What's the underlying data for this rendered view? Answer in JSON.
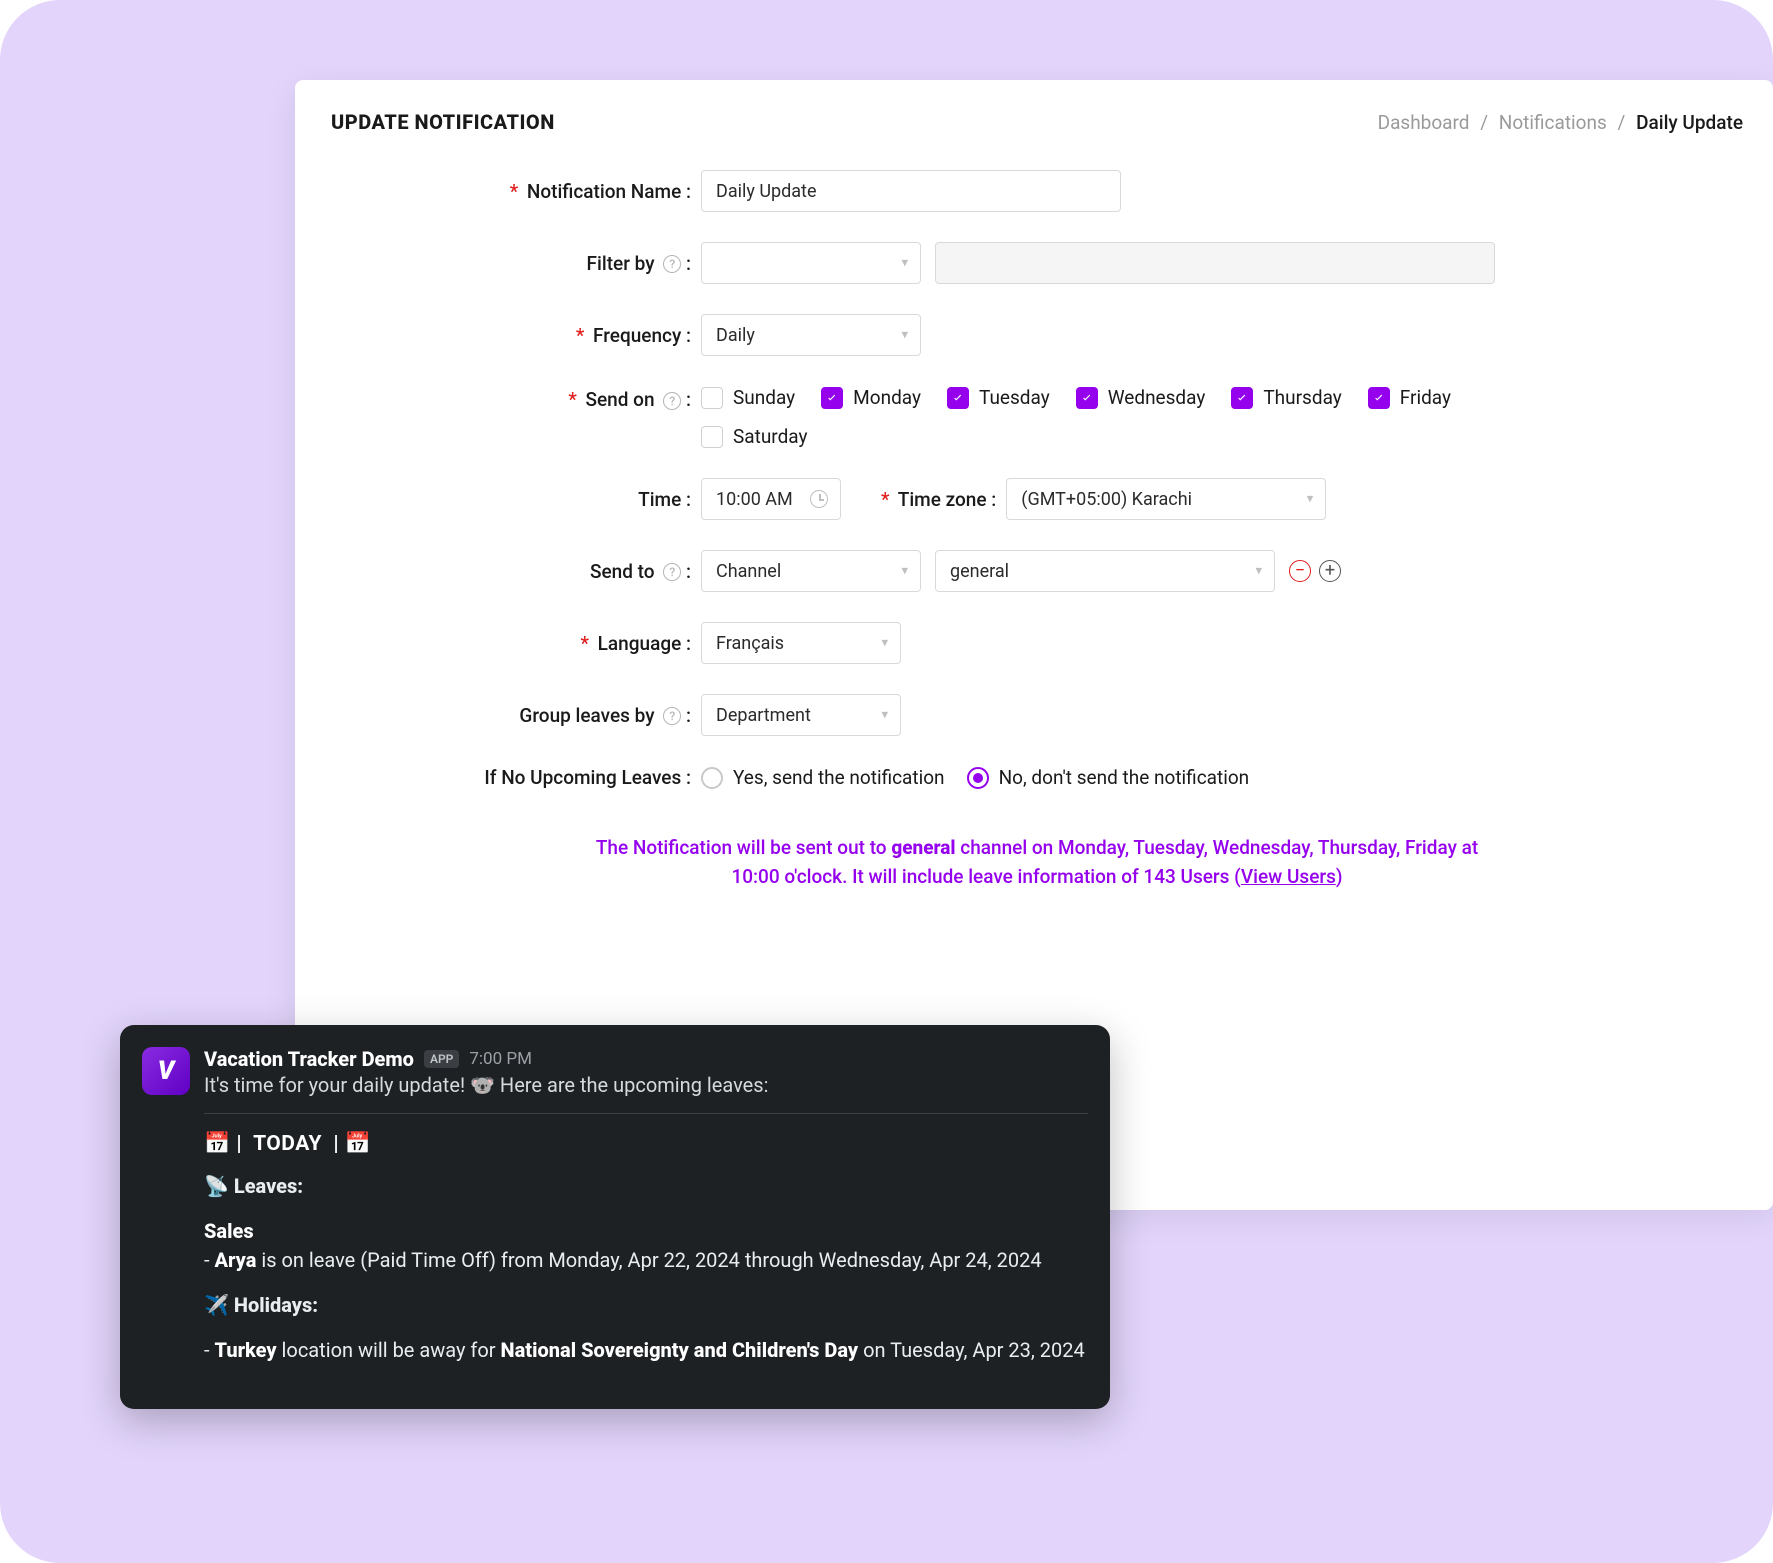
{
  "header": {
    "title": "UPDATE NOTIFICATION",
    "breadcrumb": [
      "Dashboard",
      "Notifications",
      "Daily Update"
    ]
  },
  "form": {
    "labels": {
      "notification_name": "Notification Name",
      "filter_by": "Filter by",
      "frequency": "Frequency",
      "send_on": "Send on",
      "time": "Time",
      "timezone": "Time zone",
      "send_to": "Send to",
      "language": "Language",
      "group_by": "Group leaves by",
      "if_no_leaves": "If No Upcoming Leaves"
    },
    "notification_name": "Daily Update",
    "filter_by_value": "",
    "frequency": "Daily",
    "days": [
      {
        "name": "Sunday",
        "checked": false
      },
      {
        "name": "Monday",
        "checked": true
      },
      {
        "name": "Tuesday",
        "checked": true
      },
      {
        "name": "Wednesday",
        "checked": true
      },
      {
        "name": "Thursday",
        "checked": true
      },
      {
        "name": "Friday",
        "checked": true
      },
      {
        "name": "Saturday",
        "checked": false
      }
    ],
    "time": "10:00 AM",
    "timezone": "(GMT+05:00) Karachi",
    "send_to_type": "Channel",
    "send_to_target": "general",
    "language": "Français",
    "group_by": "Department",
    "radio": {
      "yes": "Yes, send the notification",
      "no": "No, don't send the notification",
      "selected": "no"
    }
  },
  "summary": {
    "pre": "The Notification will be sent out to ",
    "channel": "general",
    "mid": " channel on Monday, Tuesday, Wednesday, Thursday, Friday at 10:00 o'clock. It will include leave information of 143 Users (",
    "link": "View Users",
    "post": ")"
  },
  "slack": {
    "app_name": "Vacation Tracker Demo",
    "app_badge": "APP",
    "time": "7:00 PM",
    "intro": "It's time for your daily update! 🐨 Here are the upcoming leaves:",
    "today_label": "TODAY",
    "leaves_label": "Leaves:",
    "holidays_label": "Holidays:",
    "group_name": "Sales",
    "leave_person": "Arya",
    "leave_rest": " is on leave (Paid Time Off) from Monday, Apr 22, 2024 through Wednesday, Apr 24, 2024",
    "holiday_location": "Turkey",
    "holiday_mid": " location will be away for ",
    "holiday_name": "National Sovereignty and Children's Day",
    "holiday_rest": " on Tuesday, Apr 23, 2024"
  }
}
